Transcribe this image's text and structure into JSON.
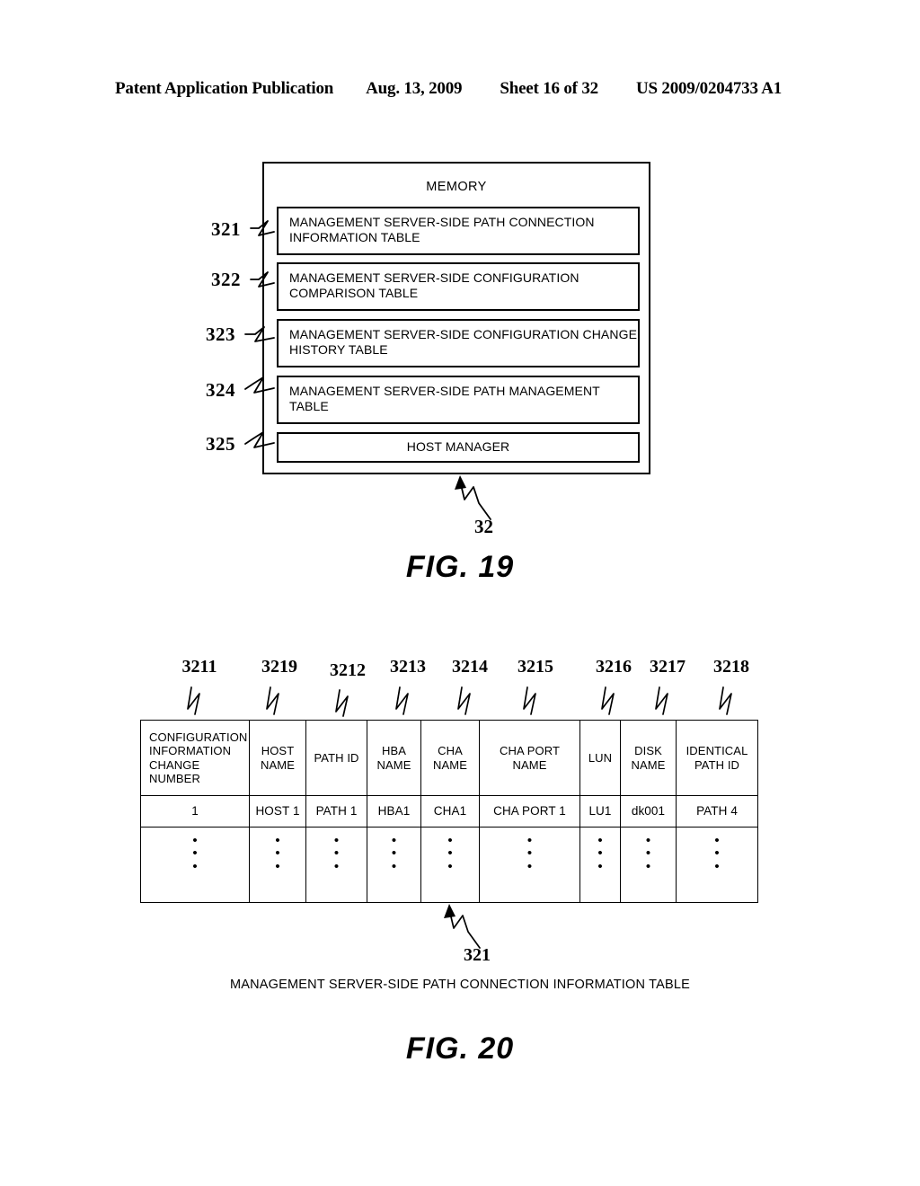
{
  "page_header": {
    "left": "Patent Application Publication",
    "date": "Aug. 13, 2009",
    "sheet": "Sheet 16 of 32",
    "pub_number": "US 2009/0204733 A1"
  },
  "fig19": {
    "label": "FIG. 19",
    "memory_title": "MEMORY",
    "block_ref": "32",
    "items": [
      {
        "ref": "321",
        "label": "MANAGEMENT SERVER-SIDE PATH CONNECTION INFORMATION TABLE"
      },
      {
        "ref": "322",
        "label": "MANAGEMENT SERVER-SIDE CONFIGURATION COMPARISON TABLE"
      },
      {
        "ref": "323",
        "label": "MANAGEMENT SERVER-SIDE CONFIGURATION CHANGE HISTORY TABLE"
      },
      {
        "ref": "324",
        "label": "MANAGEMENT SERVER-SIDE PATH MANAGEMENT TABLE"
      },
      {
        "ref": "325",
        "label": "HOST MANAGER"
      }
    ]
  },
  "fig20": {
    "label": "FIG. 20",
    "table_ref": "321",
    "caption": "MANAGEMENT SERVER-SIDE PATH CONNECTION INFORMATION TABLE",
    "column_refs": [
      "3211",
      "3219",
      "3212",
      "3213",
      "3214",
      "3215",
      "3216",
      "3217",
      "3218"
    ],
    "headers": [
      "CONFIGURATION INFORMATION CHANGE NUMBER",
      "HOST NAME",
      "PATH ID",
      "HBA NAME",
      "CHA NAME",
      "CHA PORT NAME",
      "LUN",
      "DISK NAME",
      "IDENTICAL PATH ID"
    ],
    "rows": [
      [
        "1",
        "HOST 1",
        "PATH 1",
        "HBA1",
        "CHA1",
        "CHA PORT 1",
        "LU1",
        "dk001",
        "PATH 4"
      ]
    ],
    "ellipsis": "•"
  }
}
